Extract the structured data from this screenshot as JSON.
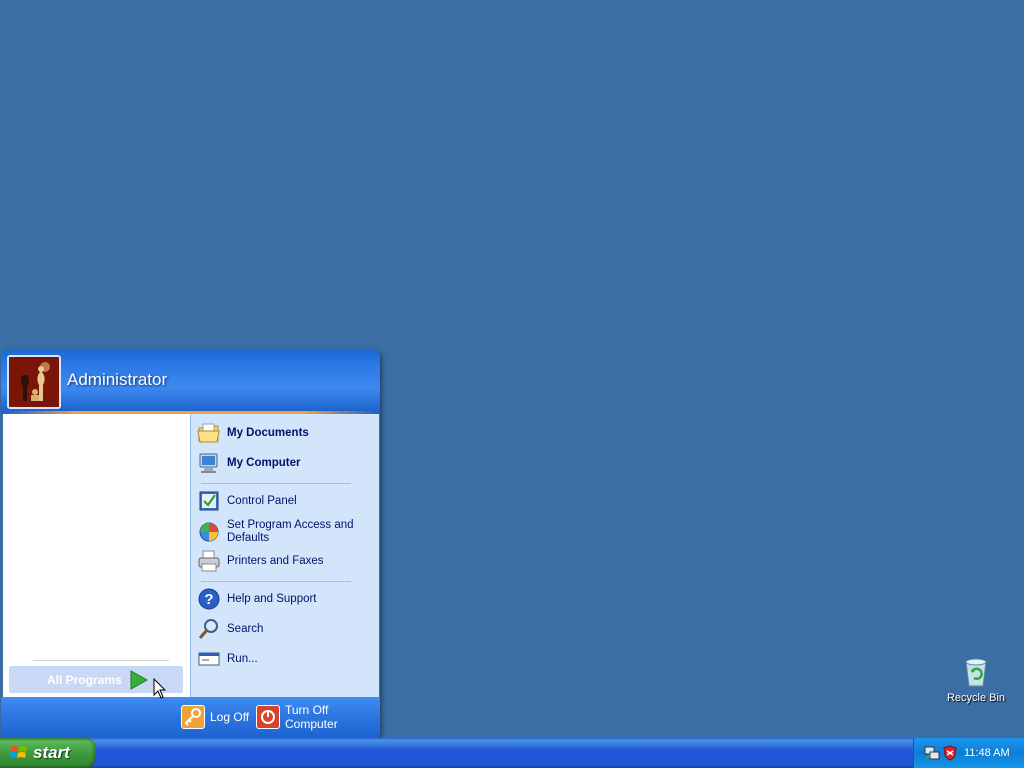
{
  "desktop": {
    "recycle_bin_label": "Recycle Bin"
  },
  "start_menu": {
    "user_name": "Administrator",
    "all_programs_label": "All Programs",
    "right_items": [
      {
        "label": "My Documents",
        "icon": "my-documents-icon",
        "bold": true
      },
      {
        "label": "My Computer",
        "icon": "my-computer-icon",
        "bold": true
      },
      {
        "label": "Control Panel",
        "icon": "control-panel-icon",
        "bold": false
      },
      {
        "label": "Set Program Access and Defaults",
        "icon": "program-access-icon",
        "bold": false
      },
      {
        "label": "Printers and Faxes",
        "icon": "printer-icon",
        "bold": false
      },
      {
        "label": "Help and Support",
        "icon": "help-icon",
        "bold": false
      },
      {
        "label": "Search",
        "icon": "search-icon",
        "bold": false
      },
      {
        "label": "Run...",
        "icon": "run-icon",
        "bold": false
      }
    ],
    "log_off_label": "Log Off",
    "turn_off_label": "Turn Off Computer"
  },
  "taskbar": {
    "start_label": "start",
    "clock": "11:48 AM"
  },
  "colors": {
    "desktop": "#3a6ea5",
    "taskbar": "#2157d7",
    "start_button": "#3e9a3e",
    "menu_right_panel": "#d3e5fa"
  }
}
